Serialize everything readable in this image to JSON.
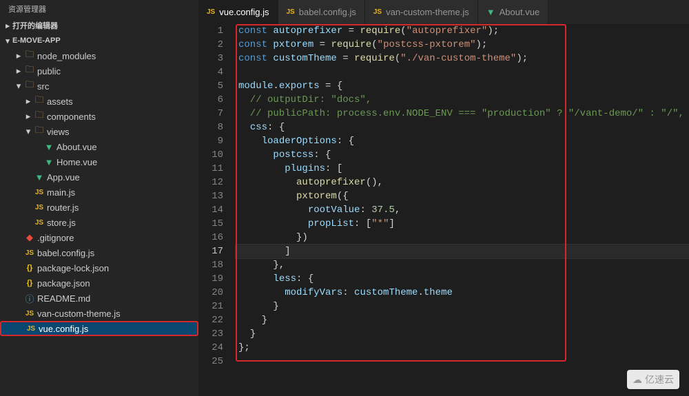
{
  "panel": {
    "title": "资源管理器"
  },
  "sections": {
    "open_editors": "打开的编辑器",
    "project": "E-MOVE-APP"
  },
  "tree": [
    {
      "name": "node_modules",
      "depth": 1,
      "kind": "folder",
      "expanded": false
    },
    {
      "name": "public",
      "depth": 1,
      "kind": "folder",
      "expanded": false
    },
    {
      "name": "src",
      "depth": 1,
      "kind": "folder",
      "expanded": true
    },
    {
      "name": "assets",
      "depth": 2,
      "kind": "folder",
      "expanded": false
    },
    {
      "name": "components",
      "depth": 2,
      "kind": "folder",
      "expanded": false
    },
    {
      "name": "views",
      "depth": 2,
      "kind": "folder",
      "expanded": true
    },
    {
      "name": "About.vue",
      "depth": 3,
      "kind": "vue"
    },
    {
      "name": "Home.vue",
      "depth": 3,
      "kind": "vue"
    },
    {
      "name": "App.vue",
      "depth": 2,
      "kind": "vue"
    },
    {
      "name": "main.js",
      "depth": 2,
      "kind": "js"
    },
    {
      "name": "router.js",
      "depth": 2,
      "kind": "js"
    },
    {
      "name": "store.js",
      "depth": 2,
      "kind": "js"
    },
    {
      "name": ".gitignore",
      "depth": 1,
      "kind": "git"
    },
    {
      "name": "babel.config.js",
      "depth": 1,
      "kind": "js"
    },
    {
      "name": "package-lock.json",
      "depth": 1,
      "kind": "json"
    },
    {
      "name": "package.json",
      "depth": 1,
      "kind": "json"
    },
    {
      "name": "README.md",
      "depth": 1,
      "kind": "md"
    },
    {
      "name": "van-custom-theme.js",
      "depth": 1,
      "kind": "js"
    },
    {
      "name": "vue.config.js",
      "depth": 1,
      "kind": "js",
      "selected": true
    }
  ],
  "tabs": [
    {
      "label": "vue.config.js",
      "kind": "js",
      "active": true
    },
    {
      "label": "babel.config.js",
      "kind": "js",
      "active": false
    },
    {
      "label": "van-custom-theme.js",
      "kind": "js",
      "active": false
    },
    {
      "label": "About.vue",
      "kind": "vue",
      "active": false
    }
  ],
  "code": {
    "active_line": 17,
    "lines": [
      [
        [
          "kw",
          "const "
        ],
        [
          "var",
          "autoprefixer"
        ],
        [
          "op",
          " = "
        ],
        [
          "fn",
          "require"
        ],
        [
          "op",
          "("
        ],
        [
          "str",
          "\"autoprefixer\""
        ],
        [
          "op",
          ");"
        ]
      ],
      [
        [
          "kw",
          "const "
        ],
        [
          "var",
          "pxtorem"
        ],
        [
          "op",
          " = "
        ],
        [
          "fn",
          "require"
        ],
        [
          "op",
          "("
        ],
        [
          "str",
          "\"postcss-pxtorem\""
        ],
        [
          "op",
          ");"
        ]
      ],
      [
        [
          "kw",
          "const "
        ],
        [
          "var",
          "customTheme"
        ],
        [
          "op",
          " = "
        ],
        [
          "fn",
          "require"
        ],
        [
          "op",
          "("
        ],
        [
          "str",
          "\"./van-custom-theme\""
        ],
        [
          "op",
          ");"
        ]
      ],
      [],
      [
        [
          "var",
          "module"
        ],
        [
          "op",
          "."
        ],
        [
          "prop",
          "exports"
        ],
        [
          "op",
          " = {"
        ]
      ],
      [
        [
          "cmt",
          "  // outputDir: \"docs\","
        ]
      ],
      [
        [
          "cmt",
          "  // publicPath: process.env.NODE_ENV === \"production\" ? \"/vant-demo/\" : \"/\","
        ]
      ],
      [
        [
          "op",
          "  "
        ],
        [
          "prop",
          "css"
        ],
        [
          "op",
          ": {"
        ]
      ],
      [
        [
          "op",
          "    "
        ],
        [
          "prop",
          "loaderOptions"
        ],
        [
          "op",
          ": {"
        ]
      ],
      [
        [
          "op",
          "      "
        ],
        [
          "prop",
          "postcss"
        ],
        [
          "op",
          ": {"
        ]
      ],
      [
        [
          "op",
          "        "
        ],
        [
          "prop",
          "plugins"
        ],
        [
          "op",
          ": ["
        ]
      ],
      [
        [
          "op",
          "          "
        ],
        [
          "fn",
          "autoprefixer"
        ],
        [
          "op",
          "(),"
        ]
      ],
      [
        [
          "op",
          "          "
        ],
        [
          "fn",
          "pxtorem"
        ],
        [
          "op",
          "({"
        ]
      ],
      [
        [
          "op",
          "            "
        ],
        [
          "prop",
          "rootValue"
        ],
        [
          "op",
          ": "
        ],
        [
          "num",
          "37.5"
        ],
        [
          "op",
          ","
        ]
      ],
      [
        [
          "op",
          "            "
        ],
        [
          "prop",
          "propList"
        ],
        [
          "op",
          ": ["
        ],
        [
          "str",
          "\"*\""
        ],
        [
          "op",
          "]"
        ]
      ],
      [
        [
          "op",
          "          })"
        ]
      ],
      [
        [
          "op",
          "        ]"
        ]
      ],
      [
        [
          "op",
          "      },"
        ]
      ],
      [
        [
          "op",
          "      "
        ],
        [
          "prop",
          "less"
        ],
        [
          "op",
          ": {"
        ]
      ],
      [
        [
          "op",
          "        "
        ],
        [
          "prop",
          "modifyVars"
        ],
        [
          "op",
          ": "
        ],
        [
          "var",
          "customTheme"
        ],
        [
          "op",
          "."
        ],
        [
          "prop",
          "theme"
        ]
      ],
      [
        [
          "op",
          "      }"
        ]
      ],
      [
        [
          "op",
          "    }"
        ]
      ],
      [
        [
          "op",
          "  }"
        ]
      ],
      [
        [
          "op",
          "};"
        ]
      ],
      []
    ]
  },
  "watermark": "亿速云"
}
